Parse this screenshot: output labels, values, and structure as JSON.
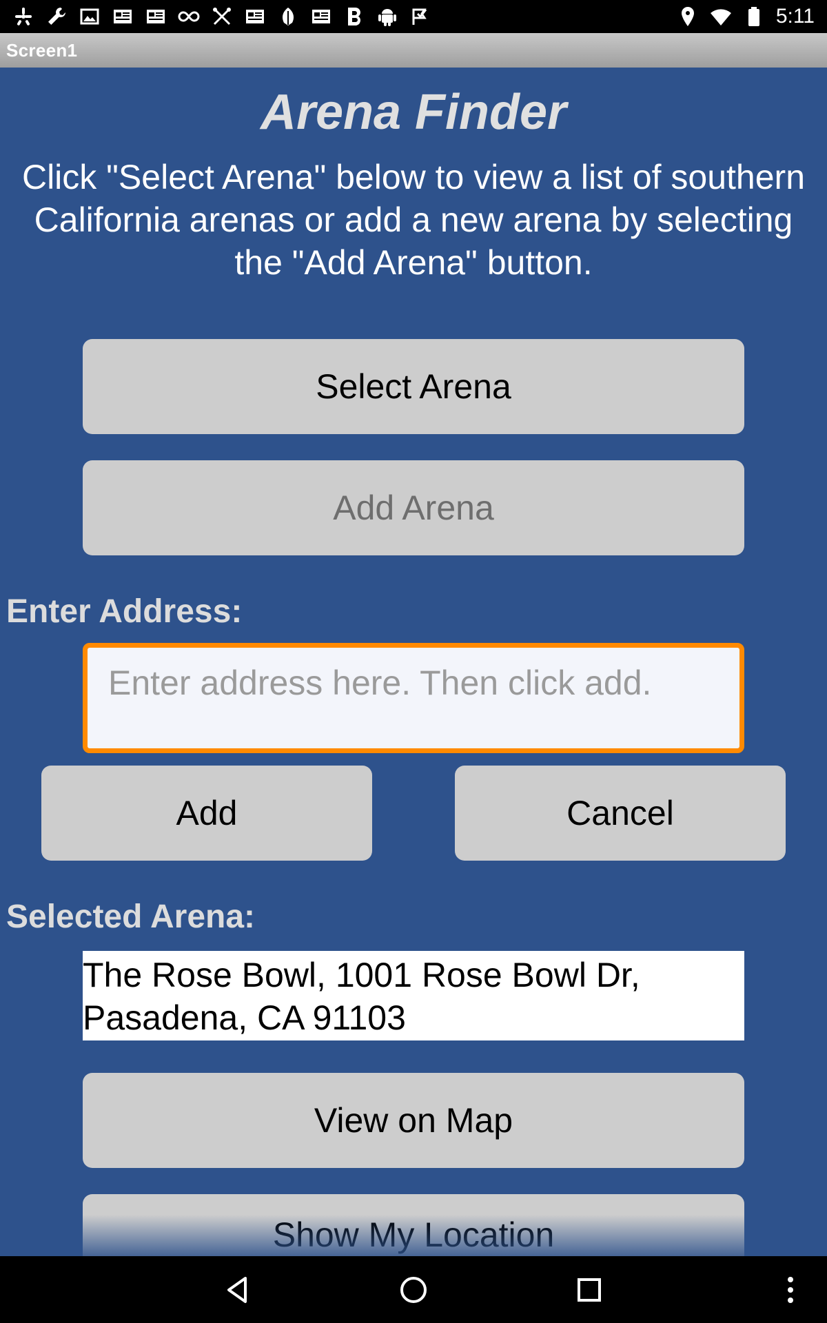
{
  "status_bar": {
    "time": "5:11",
    "left_icons": [
      "yelp-icon",
      "wrench-icon",
      "image-icon",
      "news-icon",
      "news-icon",
      "infinity-icon",
      "tools-icon",
      "news-icon",
      "leaf-icon",
      "news-icon",
      "bold-b-icon",
      "android-icon",
      "check-flag-icon"
    ],
    "right_icons": [
      "location-icon",
      "wifi-icon",
      "battery-icon"
    ]
  },
  "titlebar": {
    "title": "Screen1"
  },
  "app": {
    "title": "Arena Finder",
    "instructions": "Click \"Select Arena\" below to view a list of southern California arenas or add a new arena by selecting the \"Add Arena\" button.",
    "select_arena_label": "Select Arena",
    "add_arena_label": "Add Arena",
    "enter_address_label": "Enter Address:",
    "address_placeholder": "Enter address here. Then click add.",
    "address_value": "",
    "add_label": "Add",
    "cancel_label": "Cancel",
    "selected_arena_label": "Selected Arena:",
    "selected_arena_value": "The Rose Bowl, 1001 Rose Bowl Dr, Pasadena, CA 91103",
    "view_on_map_label": "View on Map",
    "show_my_location_label": "Show My Location"
  },
  "nav_bar": {
    "buttons": [
      "back-icon",
      "home-icon",
      "recents-icon",
      "overflow-menu-icon"
    ]
  },
  "colors": {
    "background": "#2e528c",
    "button": "#cdcdcd",
    "focus_border": "#ff8a00",
    "title_text": "#e0e0e0"
  }
}
